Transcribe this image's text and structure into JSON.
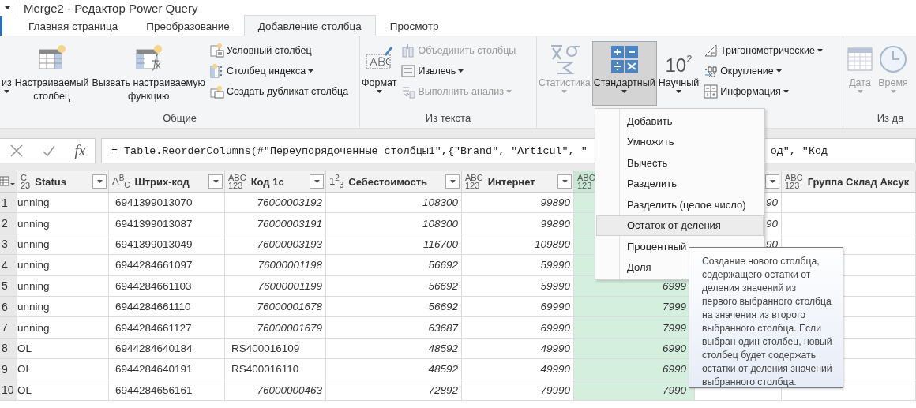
{
  "window": {
    "title": "Merge2 - Редактор Power Query"
  },
  "tabs": [
    {
      "label": "Главная страница",
      "selected": false
    },
    {
      "label": "Преобразование",
      "selected": false
    },
    {
      "label": "Добавление столбца",
      "selected": true
    },
    {
      "label": "Просмотр",
      "selected": false
    }
  ],
  "ribbon": {
    "groups": [
      {
        "label": "Общие",
        "items": [
          {
            "kind": "big",
            "label": "из",
            "dropdown": true,
            "disabled": false,
            "pressed": false
          },
          {
            "kind": "big",
            "label": "Настраиваемый\nстолбец",
            "dropdown": false,
            "disabled": false,
            "pressed": false
          },
          {
            "kind": "big",
            "label": "Вызвать настраиваемую\nфункцию",
            "dropdown": false,
            "disabled": false,
            "pressed": false
          },
          {
            "kind": "stack",
            "buttons": [
              {
                "label": "Условный столбец",
                "dropdown": false,
                "disabled": false
              },
              {
                "label": "Столбец индекса",
                "dropdown": true,
                "disabled": false
              },
              {
                "label": "Создать дубликат столбца",
                "dropdown": false,
                "disabled": false
              }
            ]
          }
        ]
      },
      {
        "label": "Из текста",
        "items": [
          {
            "kind": "big",
            "label": "Формат",
            "dropdown": true,
            "disabled": false,
            "pressed": false
          },
          {
            "kind": "stack",
            "buttons": [
              {
                "label": "Объединить столбцы",
                "dropdown": false,
                "disabled": true
              },
              {
                "label": "Извлечь",
                "dropdown": true,
                "disabled": false
              },
              {
                "label": "Выполнить анализ",
                "dropdown": true,
                "disabled": true
              }
            ]
          }
        ]
      },
      {
        "items": [
          {
            "kind": "big",
            "label": "Статистика",
            "dropdown": true,
            "disabled": true,
            "pressed": false
          },
          {
            "kind": "big",
            "label": "Стандартный",
            "dropdown": true,
            "disabled": false,
            "pressed": true
          },
          {
            "kind": "big",
            "label": "Научный",
            "glyph": "10$^{2}$",
            "dropdown": true,
            "disabled": false,
            "pressed": false
          },
          {
            "kind": "stack",
            "buttons": [
              {
                "label": "Тригонометрические",
                "dropdown": true,
                "disabled": false
              },
              {
                "label": "Округление",
                "dropdown": true,
                "disabled": false
              },
              {
                "label": "Информация",
                "dropdown": true,
                "disabled": false
              }
            ]
          }
        ]
      },
      {
        "label": "Из да",
        "items": [
          {
            "kind": "big",
            "label": "Дата",
            "dropdown": true,
            "disabled": true,
            "pressed": false
          },
          {
            "kind": "big",
            "label": "Время",
            "dropdown": true,
            "disabled": true,
            "pressed": false
          }
        ]
      }
    ]
  },
  "formula_bar": {
    "fx": "fx",
    "text_before": "= Table.ReorderColumns(#\"Переупорядоченные столбцы1\",{\"Brand\", \"Articul\", \"",
    "text_after": "од\", \"Код"
  },
  "table": {
    "columns": [
      {
        "name": "Status",
        "type": [
          "C",
          "23"
        ],
        "filter": true,
        "selected": false
      },
      {
        "name": "Штрих-код",
        "type_mark": "A$^{B}$$_{C}$",
        "filter": true,
        "selected": false
      },
      {
        "name": "Код 1с",
        "type": [
          "ABC",
          "123"
        ],
        "filter": true,
        "selected": false
      },
      {
        "name": "Себестоимость",
        "type_mark": "1$^{2}$$_{3}$",
        "filter": true,
        "selected": false
      },
      {
        "name": "Интернет",
        "type": [
          "ABC",
          "123"
        ],
        "filter": true,
        "selected": false
      },
      {
        "type": [
          "ABC",
          "123"
        ],
        "filter": false,
        "selected": true
      },
      {
        "filter": true,
        "selected": false
      },
      {
        "name": "Группа Склад Аксук",
        "type": [
          "ABC",
          "123"
        ],
        "filter": false,
        "selected": false
      }
    ],
    "rows": [
      {
        "number": "1",
        "cells": [
          {
            "text": "unning",
            "kind": "text"
          },
          {
            "text": "6941399013070",
            "kind": "text"
          },
          {
            "text": "76000003192",
            "kind": "number"
          },
          {
            "text": "108300",
            "kind": "number"
          },
          {
            "text": "99890",
            "kind": "number"
          },
          null,
          {
            "text": "90",
            "kind": "number"
          },
          null
        ]
      },
      {
        "number": "2",
        "cells": [
          {
            "text": "unning",
            "kind": "text"
          },
          {
            "text": "6941399013087",
            "kind": "text"
          },
          {
            "text": "76000003191",
            "kind": "number"
          },
          {
            "text": "108300",
            "kind": "number"
          },
          {
            "text": "99890",
            "kind": "number"
          },
          null,
          {
            "text": "90",
            "kind": "number"
          },
          null
        ]
      },
      {
        "number": "3",
        "cells": [
          {
            "text": "unning",
            "kind": "text"
          },
          {
            "text": "6941399013049",
            "kind": "text"
          },
          {
            "text": "76000003193",
            "kind": "number"
          },
          {
            "text": "116700",
            "kind": "number"
          },
          {
            "text": "109890",
            "kind": "number"
          },
          null,
          {
            "text": "90",
            "kind": "number"
          },
          null
        ]
      },
      {
        "number": "4",
        "cells": [
          {
            "text": "unning",
            "kind": "text"
          },
          {
            "text": "6944284661097",
            "kind": "text"
          },
          {
            "text": "76000001198",
            "kind": "number"
          },
          {
            "text": "56692",
            "kind": "number"
          },
          {
            "text": "59990",
            "kind": "number"
          },
          null,
          null,
          null
        ]
      },
      {
        "number": "5",
        "cells": [
          {
            "text": "unning",
            "kind": "text"
          },
          {
            "text": "6944284661103",
            "kind": "text"
          },
          {
            "text": "76000001199",
            "kind": "number"
          },
          {
            "text": "56692",
            "kind": "number"
          },
          {
            "text": "59990",
            "kind": "number"
          },
          {
            "text": "6999",
            "kind": "number"
          },
          null,
          null
        ]
      },
      {
        "number": "6",
        "cells": [
          {
            "text": "unning",
            "kind": "text"
          },
          {
            "text": "6944284661110",
            "kind": "text"
          },
          {
            "text": "76000001678",
            "kind": "number"
          },
          {
            "text": "56692",
            "kind": "number"
          },
          {
            "text": "69990",
            "kind": "number"
          },
          {
            "text": "7999",
            "kind": "number"
          },
          null,
          null
        ]
      },
      {
        "number": "7",
        "cells": [
          {
            "text": "unning",
            "kind": "text"
          },
          {
            "text": "6944284661127",
            "kind": "text"
          },
          {
            "text": "76000001679",
            "kind": "number"
          },
          {
            "text": "63687",
            "kind": "number"
          },
          {
            "text": "69990",
            "kind": "number"
          },
          {
            "text": "7999",
            "kind": "number"
          },
          null,
          null
        ]
      },
      {
        "number": "8",
        "cells": [
          {
            "text": "OL",
            "kind": "text"
          },
          {
            "text": "6944284640184",
            "kind": "text"
          },
          {
            "text": "RS400016109",
            "kind": "text"
          },
          {
            "text": "48592",
            "kind": "number"
          },
          {
            "text": "49990",
            "kind": "number"
          },
          {
            "text": "6990",
            "kind": "number"
          },
          null,
          null
        ]
      },
      {
        "number": "9",
        "cells": [
          {
            "text": "OL",
            "kind": "text"
          },
          {
            "text": "6944284640191",
            "kind": "text"
          },
          {
            "text": "RS400016110",
            "kind": "text"
          },
          {
            "text": "48592",
            "kind": "number"
          },
          {
            "text": "49990",
            "kind": "number"
          },
          {
            "text": "6990",
            "kind": "number"
          },
          null,
          null
        ]
      },
      {
        "number": "10",
        "cells": [
          {
            "text": "OL",
            "kind": "text"
          },
          {
            "text": "6944284656161",
            "kind": "text"
          },
          {
            "text": "76000000463",
            "kind": "number"
          },
          {
            "text": "72892",
            "kind": "number"
          },
          {
            "text": "79990",
            "kind": "number"
          },
          {
            "text": "7990",
            "kind": "number"
          },
          null,
          null
        ]
      }
    ]
  },
  "menu": {
    "items": [
      {
        "label": "Добавить",
        "highlighted": false
      },
      {
        "label": "Умножить",
        "highlighted": false
      },
      {
        "label": "Вычесть",
        "highlighted": false
      },
      {
        "label": "Разделить",
        "highlighted": false
      },
      {
        "label": "Разделить (целое число)",
        "highlighted": false
      },
      {
        "label": "Остаток от деления",
        "highlighted": true
      },
      {
        "label": "Процентный",
        "highlighted": false
      },
      {
        "label": "Доля",
        "highlighted": false
      }
    ]
  },
  "tooltip": {
    "text": "Создание нового столбца, содержащего остатки от деления значений из первого выбранного столбца на значения из второго выбранного столбца. Если выбран один столбец, новый столбец будет содержать остатки от деления значений выбранного столбца."
  }
}
